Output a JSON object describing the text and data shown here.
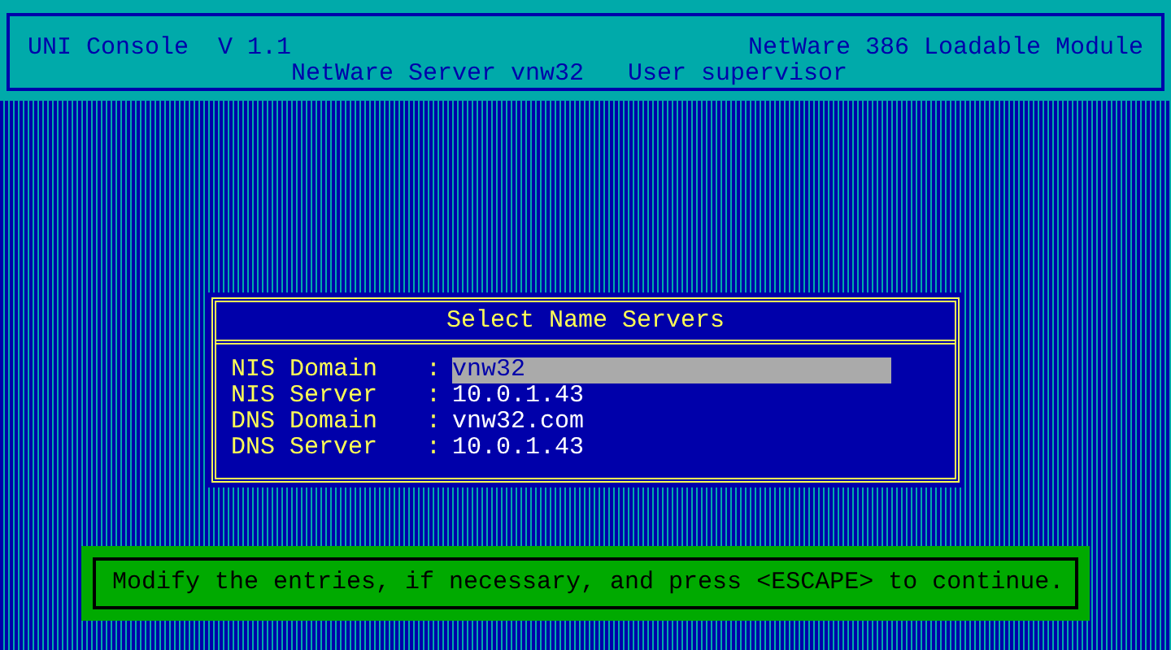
{
  "header": {
    "title": "UNI Console  V 1.1",
    "module": "NetWare 386 Loadable Module",
    "server": "NetWare Server vnw32",
    "user": "User supervisor"
  },
  "dialog": {
    "title": "Select Name Servers",
    "fields": [
      {
        "label": "NIS Domain",
        "separator": ":",
        "value": "vnw32",
        "selected": true
      },
      {
        "label": "NIS Server",
        "separator": ":",
        "value": "10.0.1.43",
        "selected": false
      },
      {
        "label": "DNS Domain",
        "separator": ":",
        "value": "vnw32.com",
        "selected": false
      },
      {
        "label": "DNS Server",
        "separator": ":",
        "value": "10.0.1.43",
        "selected": false
      }
    ]
  },
  "status": "Modify the entries, if necessary, and press <ESCAPE> to continue."
}
